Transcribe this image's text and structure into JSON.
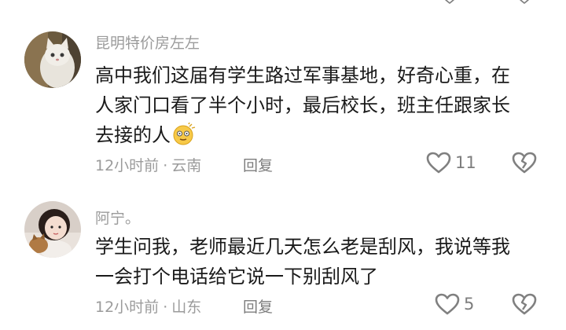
{
  "comments": [
    {
      "username": "昆明特价房左左",
      "content_lines": [
        "高中我们这届有学生路过军事基地，好奇心重，在",
        "人家门口看了半个小时，最后校长，班主任跟家长",
        "去接的人"
      ],
      "emoji_icon": "dizzy-face-emoji",
      "time": "12小时前",
      "separator": "·",
      "location": "云南",
      "reply_label": "回复",
      "like_count": "11"
    },
    {
      "username": "阿宁。",
      "content_lines": [
        "学生问我，老师最近几天怎么老是刮风，我说等我",
        "一会打个电话给它说一下别刮风了"
      ],
      "time": "12小时前",
      "separator": "·",
      "location": "山东",
      "reply_label": "回复",
      "like_count": "5"
    }
  ],
  "colors": {
    "meta_gray": "#9b9b9b",
    "text": "#1a1a1a",
    "icon_stroke": "#808080"
  }
}
